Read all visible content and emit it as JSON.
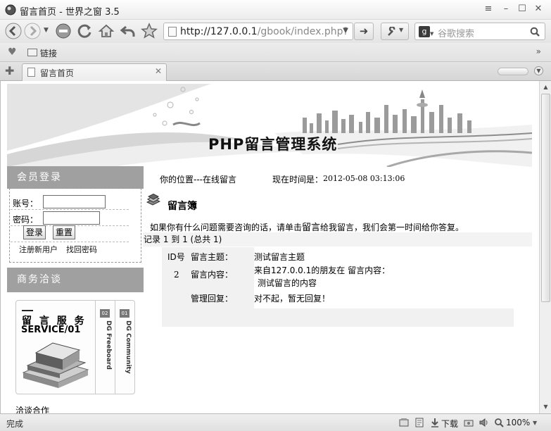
{
  "window": {
    "title": "留言首页 - 世界之窗 3.5"
  },
  "nav": {
    "url_host": "http://127.0.0.1",
    "url_path": "/gbook/index.php?",
    "search_placeholder": "谷歌搜索"
  },
  "favorites": {
    "folder_label": "链接",
    "more": "»"
  },
  "tab": {
    "label": "留言首页",
    "close": "✕"
  },
  "page": {
    "banner_title": "PHP留言管理系统",
    "sidebar": {
      "member_login_title": "会员登录",
      "account_label": "账号：",
      "password_label": "密码：",
      "login_button": "登录",
      "reset_button": "重置",
      "register_link": "注册新用户",
      "recover_link": "找回密码",
      "business_title": "商务洽谈",
      "service_title": "留 言 服 务",
      "service_subtitle": "SERVICE/01",
      "col1_num": "02",
      "col1_text": "DG Freeboard",
      "col2_num": "01",
      "col2_text": "DG Community",
      "footer_text": "洽谈合作"
    },
    "location_label": "你的位置---在线留言",
    "time_label": "现在时间是：",
    "time_value": "2012-05-08 03:13:06",
    "guestbook_title": "留言簿",
    "intro_before": "如果你有什么问题需要咨询的话，请单击",
    "intro_big": "留言",
    "intro_after": "给我留言，我们会第一时间给你答复。",
    "record_text": "记录 1 到 1 (总共 1)",
    "entry": {
      "id_header": "ID号",
      "id_value": "2",
      "subject_label": "留言主题：",
      "subject_value": "测试留言主题",
      "content_label": "留言内容：",
      "content_line1": "来自127.0.0.1的朋友在 留言内容：",
      "content_line2": "测试留言的内容",
      "reply_label": "管理回复：",
      "reply_value": "对不起，暂无回复！"
    }
  },
  "status": {
    "text": "完成",
    "download_label": "下载",
    "zoom": "100%"
  }
}
